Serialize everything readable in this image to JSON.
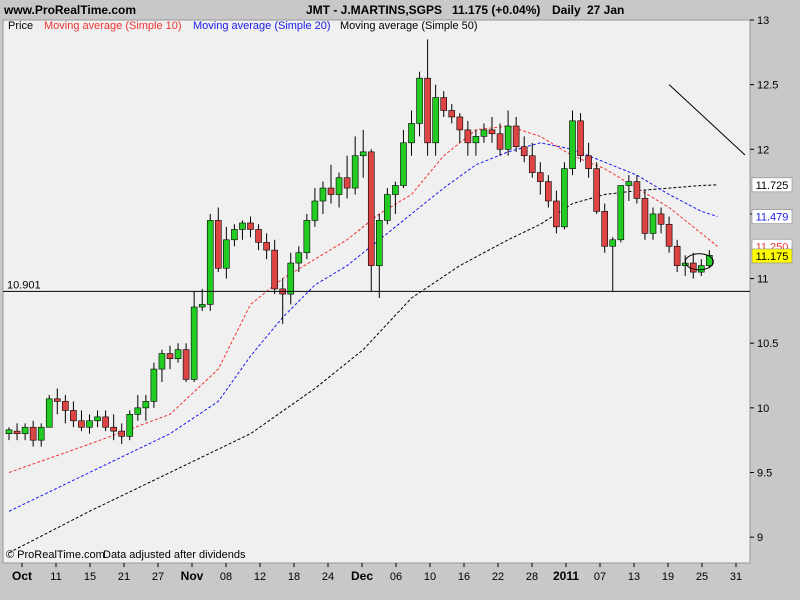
{
  "header": {
    "site": "www.ProRealTime.com",
    "title": "JMT - J.MARTINS,SGPS",
    "quote": "11.175 (+0.04%)",
    "period": "Daily",
    "date": "27 Jan"
  },
  "footer": {
    "credit": "© ProRealTime.com",
    "note": "Data adjusted after dividends"
  },
  "colors": {
    "up": "#22cc22",
    "down": "#dd4444",
    "ma10": "#ee3333",
    "ma20": "#1a1aee",
    "ma50": "#000000",
    "background": "#f0f0f0"
  },
  "chart_data": {
    "type": "candlestick",
    "legend": [
      {
        "key": "price",
        "label": "Price",
        "color": "#000000"
      },
      {
        "key": "ma10",
        "label": "Moving average (Simple 10)",
        "color": "#ee3333"
      },
      {
        "key": "ma20",
        "label": "Moving average (Simple 20)",
        "color": "#1a1aee"
      },
      {
        "key": "ma50",
        "label": "Moving average (Simple 50)",
        "color": "#000000"
      }
    ],
    "y_range": [
      8.8,
      13.0
    ],
    "y_ticks": [
      "13",
      "12.5",
      "12",
      "11.5",
      "11",
      "10.5",
      "10",
      "9.5",
      "9"
    ],
    "x_labels": [
      {
        "label": "Oct",
        "bold": true
      },
      {
        "label": "11",
        "bold": false
      },
      {
        "label": "15",
        "bold": false
      },
      {
        "label": "21",
        "bold": false
      },
      {
        "label": "27",
        "bold": false
      },
      {
        "label": "Nov",
        "bold": true
      },
      {
        "label": "08",
        "bold": false
      },
      {
        "label": "12",
        "bold": false
      },
      {
        "label": "18",
        "bold": false
      },
      {
        "label": "24",
        "bold": false
      },
      {
        "label": "Dec",
        "bold": true
      },
      {
        "label": "06",
        "bold": false
      },
      {
        "label": "10",
        "bold": false
      },
      {
        "label": "16",
        "bold": false
      },
      {
        "label": "22",
        "bold": false
      },
      {
        "label": "28",
        "bold": false
      },
      {
        "label": "2011",
        "bold": true
      },
      {
        "label": "07",
        "bold": false
      },
      {
        "label": "13",
        "bold": false
      },
      {
        "label": "19",
        "bold": false
      },
      {
        "label": "25",
        "bold": false
      },
      {
        "label": "31",
        "bold": false
      }
    ],
    "horizontal_line": {
      "label": "10.901",
      "value": 10.901
    },
    "price_boxes": [
      {
        "label": "11.725",
        "value": 11.725,
        "color": "#000000"
      },
      {
        "label": "11.479",
        "value": 11.479,
        "color": "#1a1aee"
      },
      {
        "label": "11.250",
        "value": 11.25,
        "color": "#ee3333"
      },
      {
        "label": "11.175",
        "value": 11.175,
        "color": "#000000",
        "fill": "#ffff00"
      }
    ],
    "trendline": {
      "from": {
        "bar": 82,
        "value": 12.5
      },
      "to": {
        "bar": 108,
        "value": 11.0
      }
    },
    "candles": [
      {
        "o": 9.8,
        "h": 9.85,
        "l": 9.75,
        "c": 9.83
      },
      {
        "o": 9.82,
        "h": 9.88,
        "l": 9.75,
        "c": 9.8
      },
      {
        "o": 9.8,
        "h": 9.88,
        "l": 9.75,
        "c": 9.85
      },
      {
        "o": 9.85,
        "h": 9.9,
        "l": 9.7,
        "c": 9.75
      },
      {
        "o": 9.75,
        "h": 9.88,
        "l": 9.7,
        "c": 9.85
      },
      {
        "o": 9.85,
        "h": 10.1,
        "l": 9.85,
        "c": 10.07
      },
      {
        "o": 10.07,
        "h": 10.15,
        "l": 9.95,
        "c": 10.05
      },
      {
        "o": 10.05,
        "h": 10.1,
        "l": 9.88,
        "c": 9.98
      },
      {
        "o": 9.98,
        "h": 10.05,
        "l": 9.85,
        "c": 9.9
      },
      {
        "o": 9.9,
        "h": 9.98,
        "l": 9.82,
        "c": 9.85
      },
      {
        "o": 9.85,
        "h": 9.95,
        "l": 9.8,
        "c": 9.9
      },
      {
        "o": 9.9,
        "h": 9.98,
        "l": 9.85,
        "c": 9.93
      },
      {
        "o": 9.93,
        "h": 9.98,
        "l": 9.82,
        "c": 9.85
      },
      {
        "o": 9.85,
        "h": 9.95,
        "l": 9.75,
        "c": 9.82
      },
      {
        "o": 9.82,
        "h": 9.88,
        "l": 9.72,
        "c": 9.78
      },
      {
        "o": 9.78,
        "h": 9.98,
        "l": 9.75,
        "c": 9.95
      },
      {
        "o": 9.95,
        "h": 10.1,
        "l": 9.9,
        "c": 10.0
      },
      {
        "o": 10.0,
        "h": 10.1,
        "l": 9.9,
        "c": 10.05
      },
      {
        "o": 10.05,
        "h": 10.35,
        "l": 10.0,
        "c": 10.3
      },
      {
        "o": 10.3,
        "h": 10.45,
        "l": 10.2,
        "c": 10.42
      },
      {
        "o": 10.42,
        "h": 10.48,
        "l": 10.3,
        "c": 10.38
      },
      {
        "o": 10.38,
        "h": 10.5,
        "l": 10.35,
        "c": 10.45
      },
      {
        "o": 10.45,
        "h": 10.5,
        "l": 10.2,
        "c": 10.22
      },
      {
        "o": 10.22,
        "h": 10.9,
        "l": 10.2,
        "c": 10.78
      },
      {
        "o": 10.78,
        "h": 10.92,
        "l": 10.75,
        "c": 10.8
      },
      {
        "o": 10.8,
        "h": 11.5,
        "l": 10.75,
        "c": 11.45
      },
      {
        "o": 11.45,
        "h": 11.55,
        "l": 11.05,
        "c": 11.08
      },
      {
        "o": 11.08,
        "h": 11.4,
        "l": 11.0,
        "c": 11.3
      },
      {
        "o": 11.3,
        "h": 11.42,
        "l": 11.25,
        "c": 11.38
      },
      {
        "o": 11.38,
        "h": 11.45,
        "l": 11.3,
        "c": 11.43
      },
      {
        "o": 11.43,
        "h": 11.48,
        "l": 11.32,
        "c": 11.38
      },
      {
        "o": 11.38,
        "h": 11.42,
        "l": 11.22,
        "c": 11.28
      },
      {
        "o": 11.28,
        "h": 11.35,
        "l": 11.15,
        "c": 11.22
      },
      {
        "o": 11.22,
        "h": 11.3,
        "l": 10.88,
        "c": 10.92
      },
      {
        "o": 10.92,
        "h": 11.0,
        "l": 10.65,
        "c": 10.88
      },
      {
        "o": 10.88,
        "h": 11.2,
        "l": 10.8,
        "c": 11.12
      },
      {
        "o": 11.12,
        "h": 11.25,
        "l": 11.05,
        "c": 11.2
      },
      {
        "o": 11.2,
        "h": 11.5,
        "l": 11.15,
        "c": 11.45
      },
      {
        "o": 11.45,
        "h": 11.7,
        "l": 11.4,
        "c": 11.6
      },
      {
        "o": 11.6,
        "h": 11.75,
        "l": 11.5,
        "c": 11.7
      },
      {
        "o": 11.7,
        "h": 11.88,
        "l": 11.58,
        "c": 11.65
      },
      {
        "o": 11.65,
        "h": 11.82,
        "l": 11.55,
        "c": 11.78
      },
      {
        "o": 11.78,
        "h": 11.95,
        "l": 11.62,
        "c": 11.7
      },
      {
        "o": 11.7,
        "h": 12.1,
        "l": 11.65,
        "c": 11.95
      },
      {
        "o": 11.95,
        "h": 12.15,
        "l": 11.78,
        "c": 11.98
      },
      {
        "o": 11.98,
        "h": 12.0,
        "l": 10.9,
        "c": 11.1
      },
      {
        "o": 11.1,
        "h": 11.5,
        "l": 10.85,
        "c": 11.45
      },
      {
        "o": 11.45,
        "h": 11.7,
        "l": 11.42,
        "c": 11.65
      },
      {
        "o": 11.65,
        "h": 11.75,
        "l": 11.5,
        "c": 11.72
      },
      {
        "o": 11.72,
        "h": 12.15,
        "l": 11.7,
        "c": 12.05
      },
      {
        "o": 12.05,
        "h": 12.3,
        "l": 11.95,
        "c": 12.2
      },
      {
        "o": 12.2,
        "h": 12.6,
        "l": 12.1,
        "c": 12.55
      },
      {
        "o": 12.55,
        "h": 12.85,
        "l": 11.95,
        "c": 12.05
      },
      {
        "o": 12.05,
        "h": 12.5,
        "l": 11.95,
        "c": 12.4
      },
      {
        "o": 12.4,
        "h": 12.45,
        "l": 12.25,
        "c": 12.3
      },
      {
        "o": 12.3,
        "h": 12.35,
        "l": 12.2,
        "c": 12.25
      },
      {
        "o": 12.25,
        "h": 12.28,
        "l": 12.05,
        "c": 12.15
      },
      {
        "o": 12.15,
        "h": 12.22,
        "l": 11.95,
        "c": 12.05
      },
      {
        "o": 12.05,
        "h": 12.15,
        "l": 11.95,
        "c": 12.1
      },
      {
        "o": 12.1,
        "h": 12.2,
        "l": 12.05,
        "c": 12.15
      },
      {
        "o": 12.15,
        "h": 12.25,
        "l": 12.05,
        "c": 12.12
      },
      {
        "o": 12.12,
        "h": 12.2,
        "l": 11.95,
        "c": 12.0
      },
      {
        "o": 12.0,
        "h": 12.3,
        "l": 11.95,
        "c": 12.18
      },
      {
        "o": 12.18,
        "h": 12.25,
        "l": 11.98,
        "c": 12.02
      },
      {
        "o": 12.02,
        "h": 12.1,
        "l": 11.9,
        "c": 11.95
      },
      {
        "o": 11.95,
        "h": 12.05,
        "l": 11.78,
        "c": 11.82
      },
      {
        "o": 11.82,
        "h": 11.9,
        "l": 11.65,
        "c": 11.75
      },
      {
        "o": 11.75,
        "h": 11.8,
        "l": 11.55,
        "c": 11.6
      },
      {
        "o": 11.6,
        "h": 11.68,
        "l": 11.35,
        "c": 11.4
      },
      {
        "o": 11.4,
        "h": 11.9,
        "l": 11.38,
        "c": 11.85
      },
      {
        "o": 11.85,
        "h": 12.3,
        "l": 11.8,
        "c": 12.22
      },
      {
        "o": 12.22,
        "h": 12.28,
        "l": 11.9,
        "c": 11.95
      },
      {
        "o": 11.95,
        "h": 12.05,
        "l": 11.78,
        "c": 11.85
      },
      {
        "o": 11.85,
        "h": 11.9,
        "l": 11.5,
        "c": 11.52
      },
      {
        "o": 11.52,
        "h": 11.58,
        "l": 11.2,
        "c": 11.25
      },
      {
        "o": 11.25,
        "h": 11.32,
        "l": 10.9,
        "c": 11.3
      },
      {
        "o": 11.3,
        "h": 11.7,
        "l": 11.28,
        "c": 11.72
      },
      {
        "o": 11.72,
        "h": 11.8,
        "l": 11.6,
        "c": 11.75
      },
      {
        "o": 11.75,
        "h": 11.8,
        "l": 11.58,
        "c": 11.62
      },
      {
        "o": 11.62,
        "h": 11.68,
        "l": 11.3,
        "c": 11.35
      },
      {
        "o": 11.35,
        "h": 11.55,
        "l": 11.3,
        "c": 11.5
      },
      {
        "o": 11.5,
        "h": 11.55,
        "l": 11.35,
        "c": 11.42
      },
      {
        "o": 11.42,
        "h": 11.48,
        "l": 11.2,
        "c": 11.25
      },
      {
        "o": 11.25,
        "h": 11.3,
        "l": 11.05,
        "c": 11.1
      },
      {
        "o": 11.1,
        "h": 11.18,
        "l": 11.02,
        "c": 11.12
      },
      {
        "o": 11.12,
        "h": 11.2,
        "l": 11.0,
        "c": 11.05
      },
      {
        "o": 11.05,
        "h": 11.15,
        "l": 11.02,
        "c": 11.1
      },
      {
        "o": 11.1,
        "h": 11.22,
        "l": 11.08,
        "c": 11.18
      }
    ],
    "ma10": [
      [
        0,
        9.5
      ],
      [
        10,
        9.72
      ],
      [
        20,
        9.95
      ],
      [
        26,
        10.3
      ],
      [
        30,
        10.8
      ],
      [
        34,
        11.0
      ],
      [
        38,
        11.15
      ],
      [
        42,
        11.3
      ],
      [
        46,
        11.5
      ],
      [
        50,
        11.65
      ],
      [
        54,
        11.95
      ],
      [
        58,
        12.15
      ],
      [
        62,
        12.18
      ],
      [
        66,
        12.1
      ],
      [
        70,
        11.95
      ],
      [
        74,
        11.85
      ],
      [
        78,
        11.7
      ],
      [
        82,
        11.55
      ],
      [
        86,
        11.35
      ],
      [
        88,
        11.25
      ]
    ],
    "ma20": [
      [
        0,
        9.2
      ],
      [
        10,
        9.5
      ],
      [
        20,
        9.8
      ],
      [
        26,
        10.05
      ],
      [
        30,
        10.4
      ],
      [
        34,
        10.7
      ],
      [
        38,
        10.95
      ],
      [
        42,
        11.1
      ],
      [
        46,
        11.3
      ],
      [
        50,
        11.5
      ],
      [
        54,
        11.7
      ],
      [
        58,
        11.88
      ],
      [
        62,
        11.98
      ],
      [
        66,
        12.05
      ],
      [
        70,
        12.0
      ],
      [
        74,
        11.9
      ],
      [
        78,
        11.8
      ],
      [
        82,
        11.65
      ],
      [
        86,
        11.52
      ],
      [
        88,
        11.48
      ]
    ],
    "ma50": [
      [
        0,
        8.88
      ],
      [
        10,
        9.2
      ],
      [
        20,
        9.5
      ],
      [
        30,
        9.8
      ],
      [
        38,
        10.15
      ],
      [
        44,
        10.45
      ],
      [
        50,
        10.85
      ],
      [
        56,
        11.1
      ],
      [
        62,
        11.3
      ],
      [
        66,
        11.42
      ],
      [
        70,
        11.58
      ],
      [
        74,
        11.65
      ],
      [
        78,
        11.68
      ],
      [
        82,
        11.7
      ],
      [
        86,
        11.72
      ],
      [
        88,
        11.725
      ]
    ]
  }
}
